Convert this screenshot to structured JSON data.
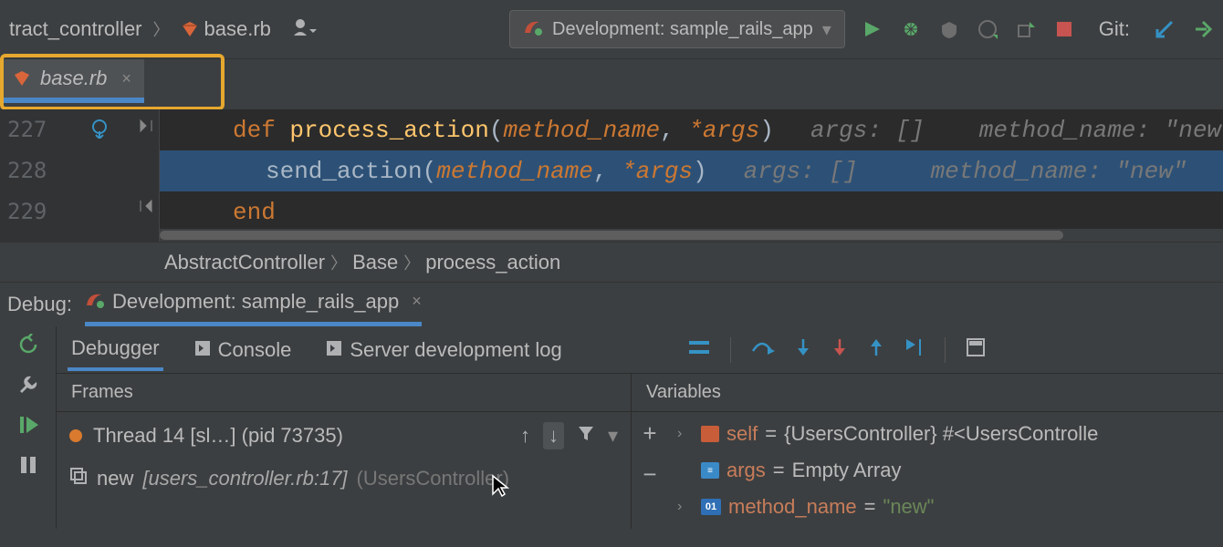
{
  "breadcrumb_top": {
    "item1": "tract_controller",
    "item2": "base.rb"
  },
  "run_config": {
    "label": "Development: sample_rails_app"
  },
  "git_label": "Git:",
  "editor_tab": {
    "name": "base.rb"
  },
  "code": {
    "line227": {
      "num": "227",
      "kw": "def",
      "method": "process_action",
      "p1": "method_name",
      "p2": "*args",
      "hint_args": "args: []",
      "hint_mn": "method_name: \"new"
    },
    "line228": {
      "num": "228",
      "method": "send_action",
      "p1": "method_name",
      "p2": "*args",
      "hint_args": "args: []",
      "hint_mn": "method_name: \"new\""
    },
    "line229": {
      "num": "229",
      "kw": "end"
    }
  },
  "editor_breadcrumb": {
    "b1": "AbstractController",
    "b2": "Base",
    "b3": "process_action"
  },
  "debug": {
    "label": "Debug:",
    "session": "Development: sample_rails_app",
    "tabs": {
      "debugger": "Debugger",
      "console": "Console",
      "log": "Server development log"
    },
    "frames_title": "Frames",
    "variables_title": "Variables",
    "thread": "Thread 14 [sl…] (pid 73735)",
    "frame1": {
      "fn": "new",
      "loc": "[users_controller.rb:17]",
      "lib": "(UsersController)"
    }
  },
  "vars": {
    "self": {
      "name": "self",
      "val": "{UsersController} #<UsersControlle"
    },
    "args": {
      "name": "args",
      "val": "Empty Array"
    },
    "method_name": {
      "name": "method_name",
      "val": "\"new\""
    }
  }
}
